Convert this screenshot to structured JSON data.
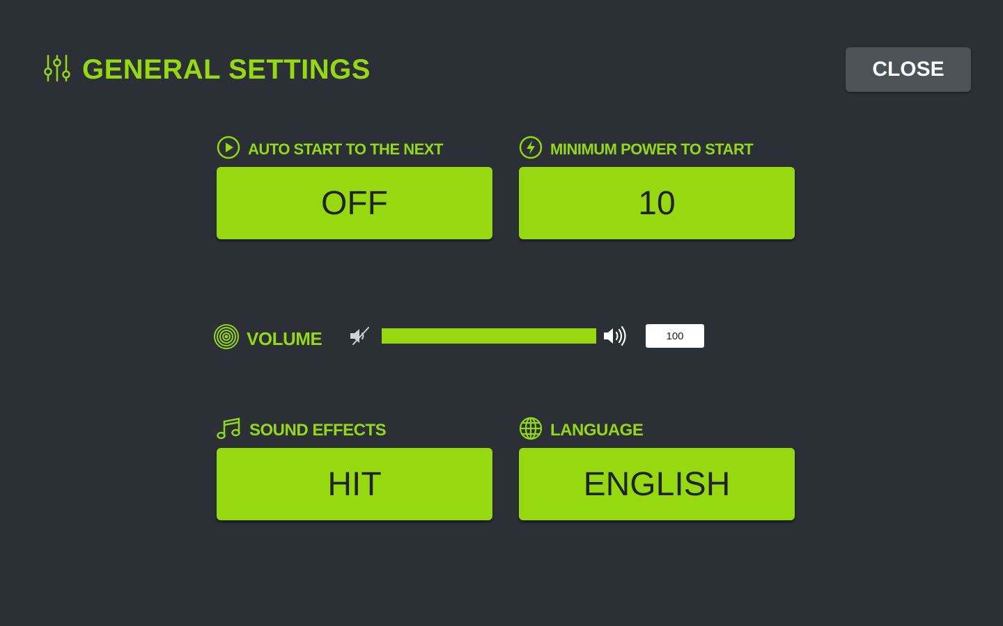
{
  "header": {
    "title": "GENERAL SETTINGS",
    "close_label": "CLOSE"
  },
  "settings": {
    "auto_start": {
      "label": "AUTO START TO THE NEXT",
      "value": "OFF"
    },
    "min_power": {
      "label": "MINIMUM POWER TO START",
      "value": "10"
    },
    "volume": {
      "label": "VOLUME",
      "value": "100",
      "level_percent": 100
    },
    "sound_effects": {
      "label": "SOUND EFFECTS",
      "value": "HIT"
    },
    "language": {
      "label": "LANGUAGE",
      "value": "ENGLISH"
    }
  },
  "icons": {
    "title": "sliders-icon",
    "auto_start": "play-circle-icon",
    "min_power": "power-bolt-icon",
    "volume": "target-rings-icon",
    "sound_effects": "music-note-icon",
    "language": "globe-icon",
    "mute": "speaker-mute-icon",
    "loud": "speaker-loud-icon"
  },
  "colors": {
    "background": "#2a3036",
    "accent": "#95d90e",
    "button_text": "#1e2326",
    "close_bg": "#4b5359"
  }
}
